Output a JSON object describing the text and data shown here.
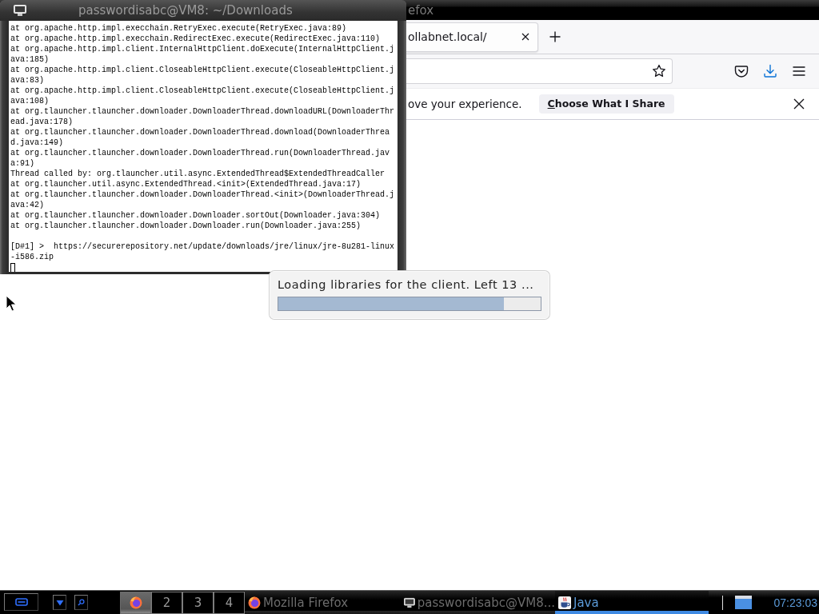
{
  "terminal": {
    "title": "passwordisabc@VM8: ~/Downloads",
    "lines": [
      {
        "kind": "output",
        "text": "at org.apache.http.impl.execchain.RetryExec.execute(RetryExec.java:89)"
      },
      {
        "kind": "output",
        "text": "at org.apache.http.impl.execchain.RedirectExec.execute(RedirectExec.java:110)"
      },
      {
        "kind": "output",
        "text": "at org.apache.http.impl.client.InternalHttpClient.doExecute(InternalHttpClient.java:185)"
      },
      {
        "kind": "output",
        "text": "at org.apache.http.impl.client.CloseableHttpClient.execute(CloseableHttpClient.java:83)"
      },
      {
        "kind": "output",
        "text": "at org.apache.http.impl.client.CloseableHttpClient.execute(CloseableHttpClient.java:108)"
      },
      {
        "kind": "output",
        "text": "at org.tlauncher.tlauncher.downloader.DownloaderThread.downloadURL(DownloaderThread.java:178)"
      },
      {
        "kind": "output",
        "text": "at org.tlauncher.tlauncher.downloader.DownloaderThread.download(DownloaderThread.java:149)"
      },
      {
        "kind": "output",
        "text": "at org.tlauncher.tlauncher.downloader.DownloaderThread.run(DownloaderThread.java:91)"
      },
      {
        "kind": "output",
        "text": "Thread called by: org.tlauncher.util.async.ExtendedThread$ExtendedThreadCaller"
      },
      {
        "kind": "output",
        "text": "at org.tlauncher.util.async.ExtendedThread.<init>(ExtendedThread.java:17)"
      },
      {
        "kind": "output",
        "text": "at org.tlauncher.tlauncher.downloader.DownloaderThread.<init>(DownloaderThread.java:42)"
      },
      {
        "kind": "output",
        "text": "at org.tlauncher.tlauncher.downloader.Downloader.sortOut(Downloader.java:304)"
      },
      {
        "kind": "output",
        "text": "at org.tlauncher.tlauncher.downloader.Downloader.run(Downloader.java:255)"
      },
      {
        "kind": "prompt",
        "text": "[D#1] >  https://securerepository.net/update/downloads/jre/linux/jre-8u281-linux-i586.zip"
      }
    ],
    "cursor": true
  },
  "browser": {
    "title": "efox",
    "tabs": [
      {
        "title": "ollabnet.local/",
        "selected": true
      }
    ],
    "notification": {
      "message": "ove your experience.",
      "button": "Choose What I Share"
    }
  },
  "loading_dialog": {
    "message": "Loading libraries for the client. Left 13 ...",
    "level": 0.86
  },
  "taskbar": {
    "pager": [
      {
        "kind": "icon",
        "selected": true
      },
      {
        "kind": "number",
        "label": "2",
        "selected": false
      },
      {
        "kind": "number",
        "label": "3",
        "selected": false
      },
      {
        "kind": "number",
        "label": "4",
        "selected": false
      }
    ],
    "tasks": [
      {
        "title": "Mozilla Firefox",
        "selected": false
      },
      {
        "title": "passwordisabc@VM8...",
        "selected": false
      },
      {
        "title": "Java",
        "selected": true
      }
    ],
    "clock": "07:23:03"
  }
}
